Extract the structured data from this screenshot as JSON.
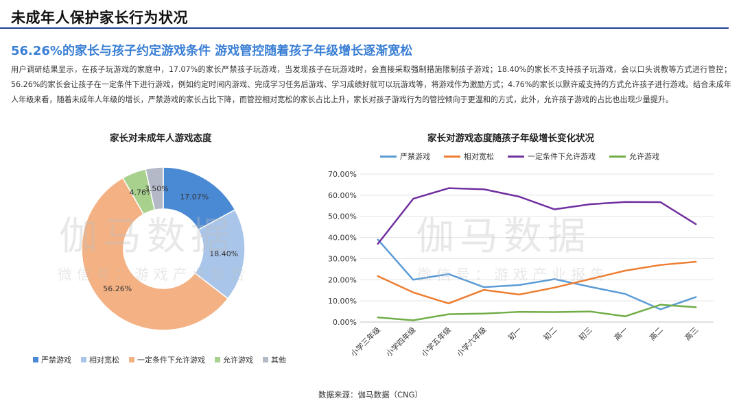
{
  "page": {
    "title": "未成年人保护家长行为状况",
    "headline": "56.26%的家长与孩子约定游戏条件  游戏管控随着孩子年级增长逐渐宽松",
    "body": "用户调研结果显示，在孩子玩游戏的家庭中，17.07%的家长严禁孩子玩游戏，当发现孩子在玩游戏时，会直接采取强制措施限制孩子游戏；18.40%的家长不支持孩子玩游戏，会以口头说教等方式进行管控；56.26%的家长会让孩子在一定条件下进行游戏，例如约定时间内游戏、完成学习任务后游戏、学习成绩好就可以玩游戏等，将游戏作为激励方式；4.76%的家长以默许或支持的方式允许孩子进行游戏。结合未成年人年级来看，随着未成年人年级的增长，严禁游戏的家长占比下降，而管控相对宽松的家长占比上升，家长对孩子游戏行为的管控倾向于更温和的方式，此外，允许孩子游戏的占比也出现少量提升。",
    "source": "数据来源：伽马数据（CNG）",
    "watermark_main": "伽马数据",
    "watermark_sub": "微信号：游戏产业报告"
  },
  "chart_data": [
    {
      "type": "pie",
      "title": "家长对未成年人游戏态度",
      "donut": true,
      "categories": [
        "严禁游戏",
        "相对宽松",
        "一定条件下允许游戏",
        "允许游戏",
        "其他"
      ],
      "values": [
        17.07,
        18.4,
        56.26,
        4.76,
        3.5
      ],
      "labels": [
        "17.07%",
        "18.40%",
        "56.26%",
        "4.76%",
        "3.50%"
      ],
      "colors": [
        "#4a89d4",
        "#a9c6ea",
        "#f4b183",
        "#a9d18e",
        "#b4b9c7"
      ],
      "legend_position": "bottom"
    },
    {
      "type": "line",
      "title": "家长对游戏态度随孩子年级增长变化状况",
      "categories": [
        "小学三年级",
        "小学四年级",
        "小学五年级",
        "小学六年级",
        "初一",
        "初二",
        "初三",
        "高一",
        "高二",
        "高三"
      ],
      "series": [
        {
          "name": "严禁游戏",
          "color": "#5b9bd5",
          "values": [
            39.0,
            20.0,
            22.7,
            16.5,
            17.5,
            20.3,
            16.7,
            13.3,
            6.0,
            11.8
          ]
        },
        {
          "name": "相对宽松",
          "color": "#ed7d31",
          "values": [
            21.7,
            14.0,
            8.8,
            15.2,
            13.0,
            16.3,
            20.3,
            24.3,
            27.0,
            28.5
          ]
        },
        {
          "name": "一定条件下允许游戏",
          "color": "#7030a0",
          "values": [
            37.0,
            58.3,
            63.3,
            62.8,
            59.3,
            53.3,
            55.7,
            56.8,
            56.7,
            46.3
          ]
        },
        {
          "name": "允许游戏",
          "color": "#70ad47",
          "values": [
            2.2,
            0.8,
            3.7,
            4.0,
            4.8,
            4.7,
            5.0,
            2.7,
            8.2,
            7.0
          ]
        }
      ],
      "y_ticks": [
        "0.00%",
        "10.00%",
        "20.00%",
        "30.00%",
        "40.00%",
        "50.00%",
        "60.00%",
        "70.00%"
      ],
      "ylim": [
        0,
        70
      ],
      "grid": true,
      "legend_position": "top"
    }
  ]
}
